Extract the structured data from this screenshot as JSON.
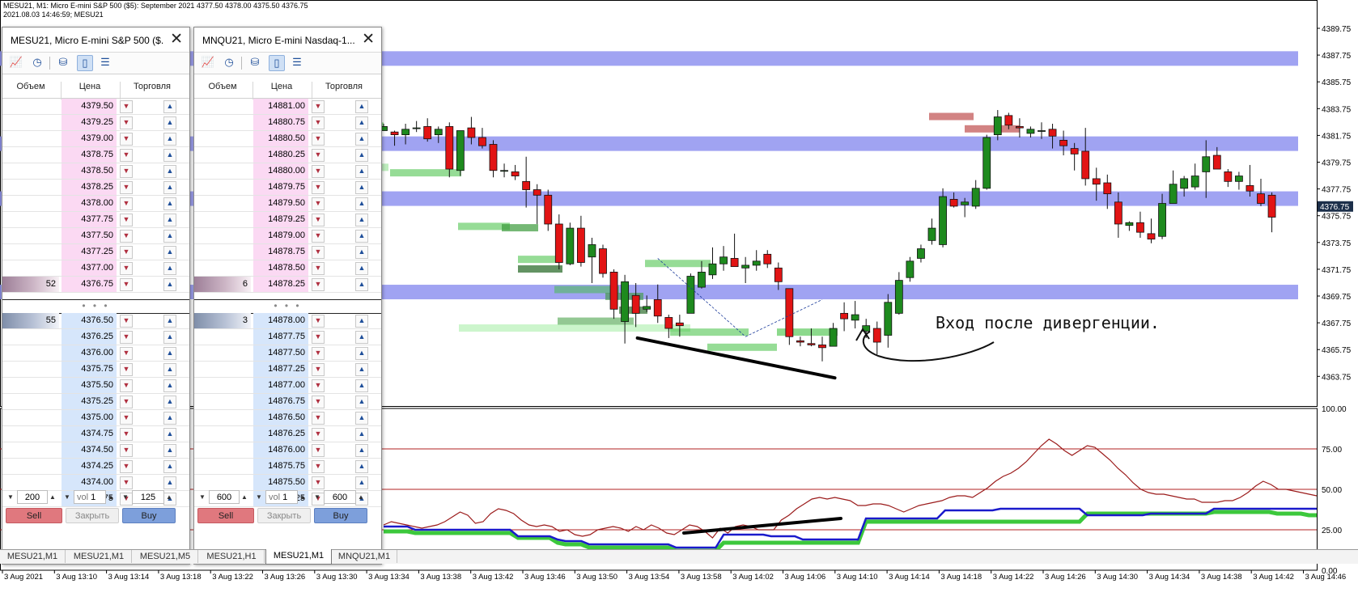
{
  "info": {
    "line1": "MESU21, M1:  Micro E-mini S&P 500 ($5): September 2021  4377.50 4378.00 4375.50 4376.75",
    "line2": "2021.08.03 14:46:59; MESU21"
  },
  "colors": {
    "bull": "#1e8a1e",
    "bear": "#e21414",
    "band": "#8f93f0",
    "bid_price": "#fbd9f3",
    "ask_price": "#d6e6fb"
  },
  "annotation": "Вход после дивергенции.",
  "price_axis": {
    "labels": [
      "4389.75",
      "4387.75",
      "4385.75",
      "4383.75",
      "4381.75",
      "4379.75",
      "4377.75",
      "4375.75",
      "4373.75",
      "4371.75",
      "4369.75",
      "4367.75",
      "4365.75",
      "4363.75"
    ],
    "current": "4376.75"
  },
  "ind_axis": {
    "labels": [
      "100.00",
      "75.00",
      "50.00",
      "25.00",
      "0.00"
    ]
  },
  "time_axis": {
    "labels": [
      "3 Aug 2021",
      "3 Aug 13:10",
      "3 Aug 13:14",
      "3 Aug 13:18",
      "3 Aug 13:22",
      "3 Aug 13:26",
      "3 Aug 13:30",
      "3 Aug 13:34",
      "3 Aug 13:38",
      "3 Aug 13:42",
      "3 Aug 13:46",
      "3 Aug 13:50",
      "3 Aug 13:54",
      "3 Aug 13:58",
      "3 Aug 14:02",
      "3 Aug 14:06",
      "3 Aug 14:10",
      "3 Aug 14:14",
      "3 Aug 14:18",
      "3 Aug 14:22",
      "3 Aug 14:26",
      "3 Aug 14:30",
      "3 Aug 14:34",
      "3 Aug 14:38",
      "3 Aug 14:42",
      "3 Aug 14:46"
    ]
  },
  "chart_data": {
    "type": "candlestick",
    "symbol": "MESU21, M1",
    "bands": [
      4387.55,
      4381.35,
      4377.35,
      4370.55
    ],
    "candles": [
      [
        4382.3,
        4382.8,
        4382.3,
        4382.6
      ],
      [
        4382.2,
        4382.3,
        4381.2,
        4382.0
      ],
      [
        4382.0,
        4382.8,
        4381.3,
        4382.4
      ],
      [
        4382.5,
        4383.0,
        4382.2,
        4382.5
      ],
      [
        4382.6,
        4383.2,
        4381.5,
        4381.7
      ],
      [
        4382.0,
        4382.6,
        4381.4,
        4382.4
      ],
      [
        4382.6,
        4382.9,
        4378.9,
        4379.5
      ],
      [
        4379.4,
        4382.3,
        4379.0,
        4382.3
      ],
      [
        4382.5,
        4383.3,
        4381.3,
        4381.8
      ],
      [
        4381.8,
        4382.5,
        4381.0,
        4381.2
      ],
      [
        4381.3,
        4381.6,
        4378.9,
        4379.4
      ],
      [
        4379.4,
        4379.9,
        4378.9,
        4379.4
      ],
      [
        4379.3,
        4379.8,
        4378.7,
        4379.0
      ],
      [
        4378.6,
        4380.4,
        4376.7,
        4378.0
      ],
      [
        4378.0,
        4378.4,
        4375.5,
        4377.6
      ],
      [
        4377.6,
        4378.0,
        4375.0,
        4375.5
      ],
      [
        4375.5,
        4376.2,
        4372.2,
        4372.7
      ],
      [
        4372.6,
        4375.6,
        4372.5,
        4375.2
      ],
      [
        4375.2,
        4376.1,
        4372.4,
        4372.7
      ],
      [
        4373.1,
        4374.5,
        4371.2,
        4374.0
      ],
      [
        4373.7,
        4374.0,
        4371.6,
        4371.9
      ],
      [
        4372.0,
        4372.2,
        4368.6,
        4369.3
      ],
      [
        4368.4,
        4371.8,
        4366.8,
        4371.3
      ],
      [
        4370.3,
        4371.2,
        4368.0,
        4369.0
      ],
      [
        4369.3,
        4370.3,
        4369.1,
        4369.5
      ],
      [
        4370.0,
        4371.1,
        4368.3,
        4368.8
      ],
      [
        4368.7,
        4368.9,
        4367.2,
        4367.9
      ],
      [
        4368.3,
        4368.9,
        4367.3,
        4368.1
      ],
      [
        4369.0,
        4371.9,
        4369.0,
        4371.7
      ],
      [
        4370.9,
        4372.8,
        4370.8,
        4372.0
      ],
      [
        4371.8,
        4373.8,
        4371.5,
        4372.6
      ],
      [
        4372.6,
        4373.9,
        4372.1,
        4373.1
      ],
      [
        4373.0,
        4374.8,
        4372.5,
        4372.4
      ],
      [
        4372.3,
        4373.1,
        4371.2,
        4372.5
      ],
      [
        4372.5,
        4373.6,
        4372.1,
        4372.8
      ],
      [
        4373.3,
        4373.6,
        4372.3,
        4372.6
      ],
      [
        4372.3,
        4372.7,
        4370.7,
        4371.3
      ],
      [
        4370.8,
        4370.8,
        4366.7,
        4367.3
      ],
      [
        4367.0,
        4367.3,
        4366.6,
        4366.9
      ],
      [
        4366.8,
        4367.9,
        4366.6,
        4366.7
      ],
      [
        4366.7,
        4367.3,
        4365.5,
        4366.5
      ],
      [
        4366.6,
        4368.3,
        4367.1,
        4367.9
      ],
      [
        4369.0,
        4369.8,
        4367.7,
        4368.6
      ],
      [
        4368.5,
        4369.9,
        4367.9,
        4368.9
      ],
      [
        4367.7,
        4368.6,
        4367.2,
        4368.1
      ],
      [
        4367.9,
        4368.4,
        4366.0,
        4366.9
      ],
      [
        4367.4,
        4370.4,
        4366.5,
        4369.8
      ],
      [
        4369.0,
        4372.0,
        4368.9,
        4371.4
      ],
      [
        4371.6,
        4373.1,
        4371.3,
        4372.8
      ],
      [
        4373.0,
        4374.0,
        4372.7,
        4373.7
      ],
      [
        4374.3,
        4375.9,
        4374.0,
        4375.2
      ],
      [
        4374.0,
        4378.1,
        4373.8,
        4377.5
      ],
      [
        4377.3,
        4377.8,
        4376.7,
        4376.8
      ],
      [
        4376.9,
        4377.4,
        4376.0,
        4377.1
      ],
      [
        4376.8,
        4378.7,
        4376.6,
        4378.1
      ],
      [
        4378.1,
        4382.0,
        4378.0,
        4381.8
      ],
      [
        4382.0,
        4383.8,
        4381.6,
        4383.3
      ],
      [
        4383.4,
        4383.6,
        4382.4,
        4382.7
      ],
      [
        4382.6,
        4383.2,
        4381.8,
        4382.5
      ],
      [
        4382.1,
        4382.6,
        4381.8,
        4382.4
      ],
      [
        4382.3,
        4382.9,
        4381.7,
        4382.3
      ],
      [
        4382.4,
        4382.8,
        4381.0,
        4381.9
      ],
      [
        4381.6,
        4382.3,
        4380.5,
        4381.2
      ],
      [
        4381.0,
        4381.4,
        4379.4,
        4380.6
      ],
      [
        4380.8,
        4382.5,
        4378.3,
        4378.8
      ],
      [
        4378.8,
        4379.6,
        4377.2,
        4378.4
      ],
      [
        4378.5,
        4379.1,
        4376.6,
        4377.7
      ],
      [
        4377.1,
        4377.8,
        4374.5,
        4375.5
      ],
      [
        4375.4,
        4375.7,
        4375.0,
        4375.6
      ],
      [
        4375.6,
        4376.4,
        4374.5,
        4374.9
      ],
      [
        4374.8,
        4375.9,
        4374.1,
        4374.4
      ],
      [
        4374.6,
        4377.7,
        4374.4,
        4377.0
      ],
      [
        4377.0,
        4379.4,
        4377.0,
        4378.4
      ],
      [
        4378.1,
        4379.0,
        4377.5,
        4378.8
      ],
      [
        4378.2,
        4379.9,
        4378.0,
        4379.0
      ],
      [
        4379.3,
        4381.6,
        4377.4,
        4380.4
      ],
      [
        4380.5,
        4381.1,
        4379.5,
        4379.5
      ],
      [
        4379.3,
        4379.5,
        4378.2,
        4378.6
      ],
      [
        4378.6,
        4379.3,
        4378.0,
        4379.0
      ],
      [
        4378.3,
        4379.8,
        4377.5,
        4377.9
      ],
      [
        4377.7,
        4378.8,
        4376.8,
        4377.0
      ],
      [
        4377.6,
        4377.8,
        4374.9,
        4376.0
      ]
    ],
    "indicator": {
      "levels": [
        75,
        50,
        25
      ],
      "red_line": [
        28,
        30,
        29,
        28,
        27,
        26,
        27,
        28,
        30,
        33,
        36,
        34,
        29,
        30,
        35,
        38,
        37,
        35,
        31,
        28,
        27,
        28,
        27,
        24,
        25,
        22,
        21,
        22,
        25,
        26,
        27,
        26,
        24,
        27,
        25,
        28,
        26,
        23,
        22,
        25,
        28,
        27,
        24,
        20,
        26,
        23,
        27,
        28,
        27,
        25,
        25,
        25,
        31,
        34,
        38,
        41,
        44,
        45,
        44,
        45,
        44,
        43,
        40,
        40,
        41,
        41,
        40,
        38,
        36,
        38,
        40,
        41,
        42,
        43,
        45,
        46,
        46,
        45,
        48,
        51,
        55,
        58,
        60,
        63,
        67,
        72,
        77,
        81,
        78,
        74,
        71,
        74,
        77,
        76,
        72,
        68,
        63,
        59,
        54,
        50,
        48,
        47,
        47,
        46,
        45,
        44,
        44,
        42,
        42,
        42,
        43,
        43,
        45,
        48,
        52,
        55,
        53,
        50,
        50,
        49,
        48,
        47,
        46
      ],
      "blue_line": [
        27,
        27,
        27,
        27,
        25,
        25,
        25,
        25,
        25,
        25,
        25,
        25,
        25,
        25,
        25,
        25,
        25,
        21,
        21,
        21,
        21,
        21,
        19,
        18,
        18,
        18,
        16,
        16,
        16,
        16,
        16,
        16,
        16,
        16,
        16,
        16,
        16,
        14,
        14,
        14,
        14,
        14,
        14,
        22,
        22,
        22,
        22,
        22,
        22,
        21,
        21,
        21,
        21,
        19,
        19,
        19,
        19,
        19,
        19,
        19,
        19,
        32,
        32,
        32,
        32,
        32,
        32,
        32,
        32,
        32,
        32,
        37,
        37,
        37,
        37,
        37,
        37,
        37,
        38,
        38,
        38,
        38,
        38,
        38,
        38,
        38,
        38,
        38,
        38,
        34,
        34,
        34,
        34,
        34,
        34,
        34,
        34,
        35,
        35,
        35,
        35,
        35,
        35,
        35,
        35,
        38,
        38,
        38,
        38,
        38,
        38,
        38,
        38,
        38,
        38,
        38,
        38,
        38,
        38
      ],
      "green_line": [
        24,
        24,
        24,
        24,
        23,
        23,
        23,
        23,
        23,
        23,
        23,
        23,
        23,
        23,
        23,
        23,
        23,
        20,
        20,
        20,
        20,
        20,
        17,
        16,
        16,
        16,
        14,
        14,
        14,
        14,
        14,
        14,
        14,
        14,
        14,
        14,
        14,
        12,
        12,
        12,
        12,
        12,
        12,
        17,
        17,
        17,
        17,
        17,
        17,
        17,
        17,
        17,
        17,
        17,
        17,
        17,
        17,
        17,
        17,
        17,
        17,
        30,
        30,
        30,
        30,
        30,
        30,
        30,
        30,
        30,
        30,
        30,
        30,
        30,
        30,
        30,
        30,
        30,
        30,
        30,
        30,
        30,
        30,
        30,
        30,
        30,
        30,
        30,
        30,
        35,
        35,
        35,
        35,
        35,
        35,
        35,
        35,
        35,
        35,
        35,
        35,
        35,
        35,
        35,
        35,
        36,
        36,
        36,
        36,
        36,
        36,
        36,
        36,
        35,
        35,
        35,
        35,
        34,
        34
      ]
    }
  },
  "dom_left": {
    "title": "MESU21, Micro E-mini S&P 500 ($...",
    "headers": {
      "vol": "Объем",
      "price": "Цена",
      "trade": "Торговля"
    },
    "asks": [
      {
        "price": "4379.50",
        "vol": ""
      },
      {
        "price": "4379.25",
        "vol": ""
      },
      {
        "price": "4379.00",
        "vol": ""
      },
      {
        "price": "4378.75",
        "vol": ""
      },
      {
        "price": "4378.50",
        "vol": ""
      },
      {
        "price": "4378.25",
        "vol": ""
      },
      {
        "price": "4378.00",
        "vol": ""
      },
      {
        "price": "4377.75",
        "vol": ""
      },
      {
        "price": "4377.50",
        "vol": ""
      },
      {
        "price": "4377.25",
        "vol": ""
      },
      {
        "price": "4377.00",
        "vol": ""
      },
      {
        "price": "4376.75",
        "vol": "52"
      }
    ],
    "bids": [
      {
        "price": "4376.50",
        "vol": "55"
      },
      {
        "price": "4376.25",
        "vol": ""
      },
      {
        "price": "4376.00",
        "vol": ""
      },
      {
        "price": "4375.75",
        "vol": ""
      },
      {
        "price": "4375.50",
        "vol": ""
      },
      {
        "price": "4375.25",
        "vol": ""
      },
      {
        "price": "4375.00",
        "vol": ""
      },
      {
        "price": "4374.75",
        "vol": ""
      },
      {
        "price": "4374.50",
        "vol": ""
      },
      {
        "price": "4374.25",
        "vol": ""
      },
      {
        "price": "4374.00",
        "vol": ""
      },
      {
        "price": "4373.75",
        "vol": ""
      }
    ],
    "spread_dots": "• • •",
    "footer": {
      "qty_left": "200",
      "vol_label": "vol",
      "vol": "1",
      "qty_right": "125"
    },
    "buttons": {
      "sell": "Sell",
      "close": "Закрыть",
      "buy": "Buy"
    }
  },
  "dom_right": {
    "title": "MNQU21, Micro E-mini Nasdaq-1...",
    "headers": {
      "vol": "Объем",
      "price": "Цена",
      "trade": "Торговля"
    },
    "asks": [
      {
        "price": "14881.00",
        "vol": ""
      },
      {
        "price": "14880.75",
        "vol": ""
      },
      {
        "price": "14880.50",
        "vol": ""
      },
      {
        "price": "14880.25",
        "vol": ""
      },
      {
        "price": "14880.00",
        "vol": ""
      },
      {
        "price": "14879.75",
        "vol": ""
      },
      {
        "price": "14879.50",
        "vol": ""
      },
      {
        "price": "14879.25",
        "vol": ""
      },
      {
        "price": "14879.00",
        "vol": ""
      },
      {
        "price": "14878.75",
        "vol": ""
      },
      {
        "price": "14878.50",
        "vol": ""
      },
      {
        "price": "14878.25",
        "vol": "6"
      }
    ],
    "bids": [
      {
        "price": "14878.00",
        "vol": "3"
      },
      {
        "price": "14877.75",
        "vol": ""
      },
      {
        "price": "14877.50",
        "vol": ""
      },
      {
        "price": "14877.25",
        "vol": ""
      },
      {
        "price": "14877.00",
        "vol": ""
      },
      {
        "price": "14876.75",
        "vol": ""
      },
      {
        "price": "14876.50",
        "vol": ""
      },
      {
        "price": "14876.25",
        "vol": ""
      },
      {
        "price": "14876.00",
        "vol": ""
      },
      {
        "price": "14875.75",
        "vol": ""
      },
      {
        "price": "14875.50",
        "vol": ""
      },
      {
        "price": "14875.25",
        "vol": ""
      }
    ],
    "spread_dots": "• • •",
    "footer": {
      "qty_left": "600",
      "vol_label": "vol",
      "vol": "1",
      "qty_right": "600"
    },
    "buttons": {
      "sell": "Sell",
      "close": "Закрыть",
      "buy": "Buy"
    }
  },
  "tabs": [
    "MESU21,M1",
    "MESU21,M1",
    "MESU21,M5",
    "MESU21,H1",
    "MESU21,M1",
    "MNQU21,M1"
  ],
  "active_tab": 4
}
